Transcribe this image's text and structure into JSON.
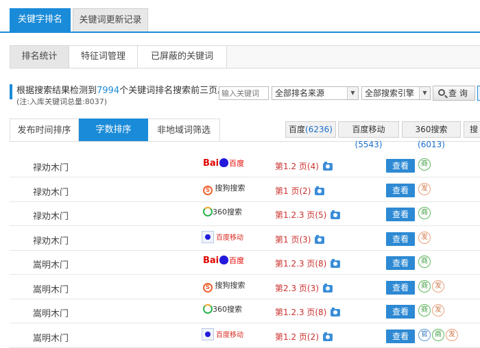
{
  "top_tabs": [
    {
      "label": "关键字排名",
      "active": true
    },
    {
      "label": "关键词更新记录",
      "active": false
    }
  ],
  "sub_tabs": [
    {
      "label": "排名统计",
      "active": true
    },
    {
      "label": "特征词管理",
      "active": false
    },
    {
      "label": "已屏蔽的关键词",
      "active": false
    }
  ],
  "info": {
    "prefix": "根据搜索结果检测到",
    "count": "7994",
    "suffix": "个关键词排名搜索前三页。",
    "note": "(注:入库关键词总量:8037)"
  },
  "filter": {
    "keyword_placeholder": "输入关键词",
    "source_select": "全部排名来源",
    "engine_select": "全部搜索引擎",
    "query_label": "查 询"
  },
  "sort_tabs": [
    {
      "label": "发布时间排序",
      "active": false
    },
    {
      "label": "字数排序",
      "active": true
    },
    {
      "label": "非地域词筛选",
      "active": false
    }
  ],
  "source_buttons": [
    {
      "name": "百度",
      "count": "(6236)"
    },
    {
      "name": "百度移动",
      "count": "(5543)"
    },
    {
      "name": "360搜索",
      "count": "(6013)"
    },
    {
      "name": "搜",
      "count": ""
    }
  ],
  "colors": {
    "accent": "#1a8bd8",
    "rank_red": "#c9302c",
    "view_button": "#2d89d3"
  },
  "rows": [
    {
      "keyword": "禄劝木门",
      "engine": "baidu",
      "engine_text": [
        "Bai",
        "百度"
      ],
      "rank": "第1.2 页(4)",
      "view": "查看",
      "badges": [
        "商"
      ]
    },
    {
      "keyword": "禄劝木门",
      "engine": "sogou",
      "engine_text": [
        "S",
        "搜狗搜索"
      ],
      "rank": "第1 页(2)",
      "view": "查看",
      "badges": [
        "发"
      ]
    },
    {
      "keyword": "禄劝木门",
      "engine": "360",
      "engine_text": [
        "",
        "360搜索"
      ],
      "rank": "第1.2.3 页(5)",
      "view": "查看",
      "badges": [
        "商"
      ]
    },
    {
      "keyword": "禄劝木门",
      "engine": "baidu_mobile",
      "engine_text": [
        "",
        "百度移动"
      ],
      "rank": "第1 页(3)",
      "view": "查看",
      "badges": [
        "发"
      ]
    },
    {
      "keyword": "嵩明木门",
      "engine": "baidu",
      "engine_text": [
        "Bai",
        "百度"
      ],
      "rank": "第1.2.3 页(8)",
      "view": "查看",
      "badges": [
        "商"
      ]
    },
    {
      "keyword": "嵩明木门",
      "engine": "sogou",
      "engine_text": [
        "S",
        "搜狗搜索"
      ],
      "rank": "第2.3 页(3)",
      "view": "查看",
      "badges": [
        "商",
        "发"
      ]
    },
    {
      "keyword": "嵩明木门",
      "engine": "360",
      "engine_text": [
        "",
        "360搜索"
      ],
      "rank": "第1.2.3 页(8)",
      "view": "查看",
      "badges": [
        "商",
        "发"
      ]
    },
    {
      "keyword": "嵩明木门",
      "engine": "baidu_mobile",
      "engine_text": [
        "",
        "百度移动"
      ],
      "rank": "第1.2 页(2)",
      "view": "查看",
      "badges": [
        "官",
        "商",
        "发"
      ]
    }
  ]
}
